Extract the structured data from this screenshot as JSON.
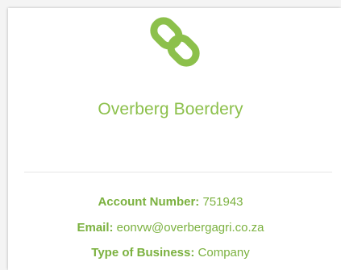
{
  "account": {
    "name": "Overberg Boerdery",
    "logo_icon": "chain-link-icon",
    "brand_color": "#8cc04b",
    "details": {
      "account_number_label": "Account Number:",
      "account_number_value": "751943",
      "email_label": "Email:",
      "email_value": "eonvw@overbergagri.co.za",
      "business_type_label": "Type of Business:",
      "business_type_value": "Company"
    }
  }
}
